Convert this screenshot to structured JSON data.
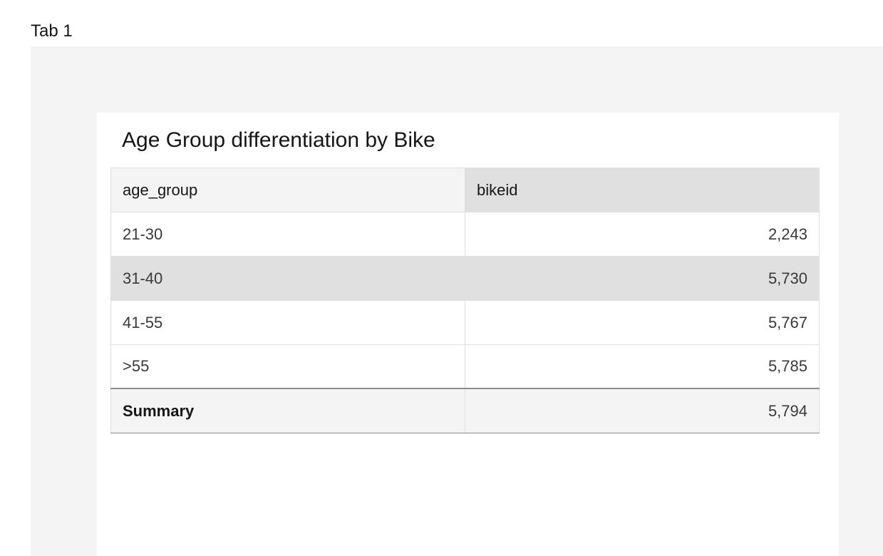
{
  "tab": {
    "label": "Tab 1"
  },
  "widget": {
    "title": "Age Group differentiation by Bike",
    "columns": [
      "age_group",
      "bikeid"
    ],
    "rows": [
      {
        "age_group": "21-30",
        "bikeid": "2,243"
      },
      {
        "age_group": "31-40",
        "bikeid": "5,730"
      },
      {
        "age_group": "41-55",
        "bikeid": "5,767"
      },
      {
        "age_group": ">55",
        "bikeid": "5,785"
      }
    ],
    "summary": {
      "label": "Summary",
      "value": "5,794"
    }
  },
  "colors": {
    "canvas_bg": "#f4f4f4",
    "highlight_row": "#e0e0e0",
    "text": "#161616"
  }
}
